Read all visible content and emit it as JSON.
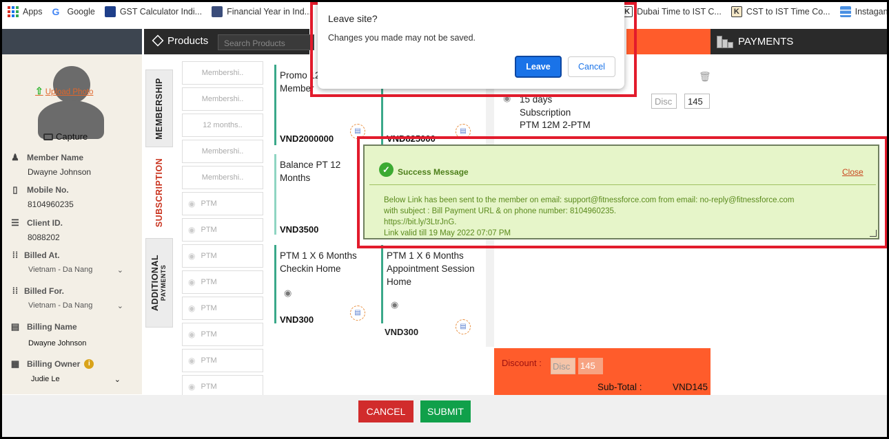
{
  "bookmarks": [
    {
      "label": "Apps",
      "icon": "apps-grid-icon"
    },
    {
      "label": "Google",
      "icon": "google-icon"
    },
    {
      "label": "GST Calculator Indi...",
      "icon": "gst-icon"
    },
    {
      "label": "Financial Year in Ind...",
      "icon": "people-icon"
    },
    {
      "label": "Dubai Time to IST C...",
      "icon": "k-icon"
    },
    {
      "label": "CST to IST Time Co...",
      "icon": "k-icon"
    },
    {
      "label": "Instagantt",
      "icon": "instagantt-icon"
    }
  ],
  "member": {
    "upload_photo": "Upload Photo",
    "capture": "Capture",
    "name_label": "Member Name",
    "name": "Dwayne Johnson",
    "mobile_label": "Mobile No.",
    "mobile": "8104960235",
    "client_id_label": "Client ID.",
    "client_id": "8088202",
    "billed_at_label": "Billed At.",
    "billed_at": "Vietnam - Da Nang",
    "billed_for_label": "Billed For.",
    "billed_for": "Vietnam - Da Nang",
    "billing_name_label": "Billing Name",
    "billing_name": "Dwayne  Johnson",
    "billing_owner_label": "Billing Owner",
    "billing_owner": "Judie Le"
  },
  "products": {
    "title": "Products",
    "search_placeholder": "Search Products",
    "tabs": {
      "membership": "MEMBERSHIP",
      "subscription": "SUBSCRIPTION",
      "additional": "ADDITIONAL",
      "payments": "PAYMENTS"
    },
    "list": [
      "Membershi..",
      "Membershi..",
      "12 months..",
      "Membershi..",
      "Membershi..",
      "PTM",
      "PTM",
      "PTM",
      "PTM",
      "PTM",
      "PTM",
      "PTM",
      "PTM"
    ],
    "cards": [
      {
        "name": "Promo 12 Member",
        "price": "VND2000000"
      },
      {
        "name": "",
        "price": "VND825000"
      },
      {
        "name": "Balance PT 12 Months",
        "price": "VND3500"
      },
      {
        "name": "PTM 1 X 6 Months Checkin Home",
        "price": "VND300"
      },
      {
        "name": "PTM 1 X 6 Months Appointment Session Home",
        "price": "VND300"
      }
    ]
  },
  "cart": {
    "line1": "15 days",
    "line2": "Subscription",
    "line3": "PTM 12M 2-PTM",
    "disc_placeholder": "Disc",
    "amount": "145",
    "discount_label": "Discount :",
    "discount_value": "145",
    "subtotal_label": "Sub-Total  :",
    "subtotal_value": "VND145"
  },
  "payments": {
    "title": "PAYMENTS"
  },
  "footer": {
    "cancel": "CANCEL",
    "submit": "SUBMIT"
  },
  "leave_dialog": {
    "title": "Leave site?",
    "message": "Changes you made may not be saved.",
    "leave": "Leave",
    "cancel": "Cancel"
  },
  "success": {
    "title": "Success Message",
    "close": "Close",
    "line1": "Below Link has been sent to the member on email: support@fitnessforce.com from email: no-reply@fitnessforce.com",
    "line2": "with subject : Bill Payment URL & on phone number: 8104960235.",
    "line3": "https://bit.ly/3LtrJnG.",
    "line4": "Link valid till 19 May 2022 07:07 PM"
  },
  "colors": {
    "accent_orange": "#ff5c2b",
    "header_dark": "#2a2a2a",
    "success_bg": "#e6f5c9",
    "cancel_red": "#d12c2c",
    "submit_green": "#10a04a"
  }
}
